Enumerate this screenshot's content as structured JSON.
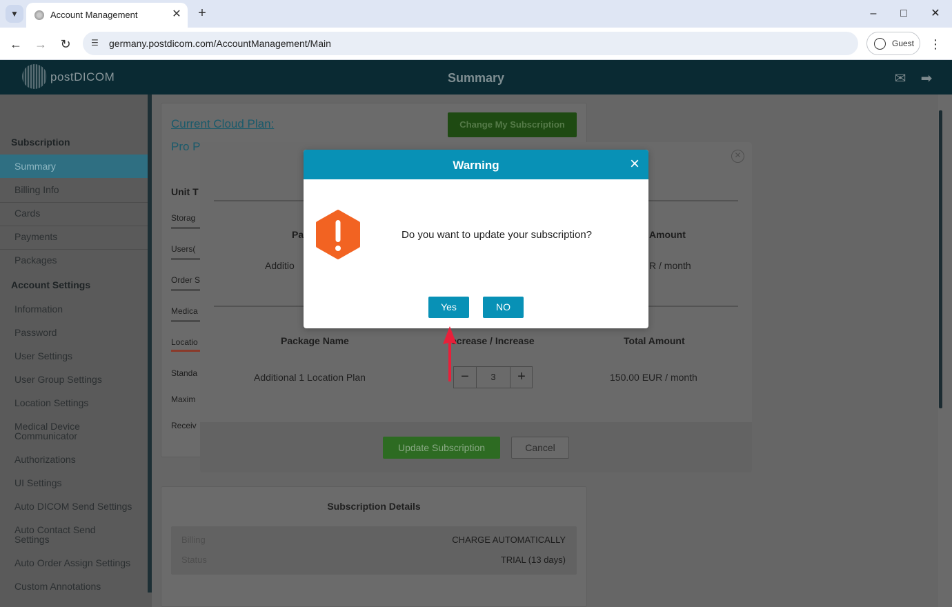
{
  "browser": {
    "tab_title": "Account Management",
    "url": "germany.postdicom.com/AccountManagement/Main",
    "profile_label": "Guest"
  },
  "app": {
    "logo_text": "postDICOM",
    "header_title": "Summary"
  },
  "sidebar": {
    "section_subscription": "Subscription",
    "section_account": "Account Settings",
    "subscription_items": [
      "Summary",
      "Billing Info",
      "Cards",
      "Payments",
      "Packages"
    ],
    "account_items": [
      "Information",
      "Password",
      "User Settings",
      "User Group Settings",
      "Location Settings",
      "Medical Device Communicator",
      "Authorizations",
      "UI Settings",
      "Auto DICOM Send Settings",
      "Auto Contact Send Settings",
      "Auto Order Assign Settings",
      "Custom Annotations"
    ],
    "active_item": "Summary"
  },
  "plan_card": {
    "title": "Current Cloud Plan:",
    "plan_name": "Pro P",
    "change_button": "Change My Subscription",
    "unit_type_label": "Unit T",
    "units": [
      "Storag",
      "Users(",
      "Order S",
      "Medica",
      "Locatio",
      "Standa",
      "Maxim",
      "Receiv"
    ]
  },
  "package_modal": {
    "row1": {
      "head_name": "Pa",
      "head_amount": "Amount",
      "name": "Additio",
      "amount": "R / month"
    },
    "row2": {
      "head_name": "Package Name",
      "head_change": "ecrease / Increase",
      "head_amount": "Total Amount",
      "name": "Additional 1 Location Plan",
      "quantity": "3",
      "amount": "150.00 EUR / month"
    },
    "update_button": "Update Subscription",
    "cancel_button": "Cancel"
  },
  "details": {
    "title": "Subscription Details",
    "rows": [
      {
        "label": "Billing",
        "value": "CHARGE AUTOMATICALLY"
      },
      {
        "label": "Status",
        "value": "TRIAL (13 days)"
      }
    ]
  },
  "warning": {
    "title": "Warning",
    "message": "Do you want to update your subscription?",
    "yes": "Yes",
    "no": "NO"
  },
  "colors": {
    "accent": "#0891b6",
    "warning_icon": "#f26322",
    "arrow": "#e8203a"
  }
}
